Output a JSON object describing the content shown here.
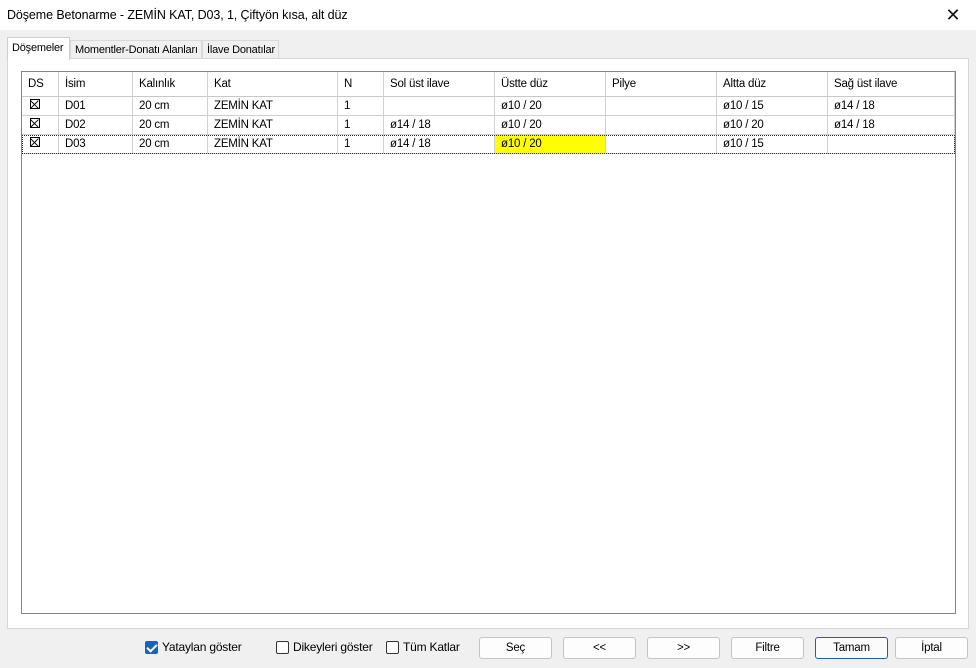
{
  "window": {
    "title": "Döşeme Betonarme - ZEMİN KAT, D03, 1, Çiftyön kısa, alt düz",
    "close_glyph": "✕"
  },
  "tabs": [
    {
      "label": "Döşemeler",
      "active": true
    },
    {
      "label": "Momentler-Donatı Alanları",
      "active": false
    },
    {
      "label": "İlave Donatılar",
      "active": false
    }
  ],
  "table": {
    "columns": [
      "DS",
      "İsim",
      "Kalınlık",
      "Kat",
      "N",
      "Sol üst ilave",
      "Üstte düz",
      "Pilye",
      "Altta düz",
      "Sağ üst ilave"
    ],
    "rows": [
      {
        "ds": true,
        "isim": "D01",
        "kalinlik": "20 cm",
        "kat": "ZEMİN KAT",
        "n": "1",
        "sol_ust": "",
        "ustte_duz": "ø10 / 20",
        "pilye": "",
        "altta_duz": "ø10 / 15",
        "sag_ust": "ø14 / 18"
      },
      {
        "ds": true,
        "isim": "D02",
        "kalinlik": "20 cm",
        "kat": "ZEMİN KAT",
        "n": "1",
        "sol_ust": "ø14 / 18",
        "ustte_duz": "ø10 / 20",
        "pilye": "",
        "altta_duz": "ø10 / 20",
        "sag_ust": "ø14 / 18"
      },
      {
        "ds": true,
        "isim": "D03",
        "kalinlik": "20 cm",
        "kat": "ZEMİN KAT",
        "n": "1",
        "sol_ust": "ø14 / 18",
        "ustte_duz": "ø10 / 20",
        "pilye": "",
        "altta_duz": "ø10 / 15",
        "sag_ust": "",
        "selected": true,
        "highlight_color": "#ffff00"
      }
    ]
  },
  "footer": {
    "checkboxes": [
      {
        "label": "Yataylan göster",
        "checked": true
      },
      {
        "label": "Dikeyleri göster",
        "checked": false
      },
      {
        "label": "Tüm Katlar",
        "checked": false
      }
    ],
    "buttons": {
      "sec": "Seç",
      "prev": "<<",
      "next": ">>",
      "filtre": "Filtre",
      "tamam": "Tamam",
      "iptal": "İptal"
    }
  },
  "colors": {
    "accent": "#1565c0",
    "highlight": "#ffff00"
  }
}
